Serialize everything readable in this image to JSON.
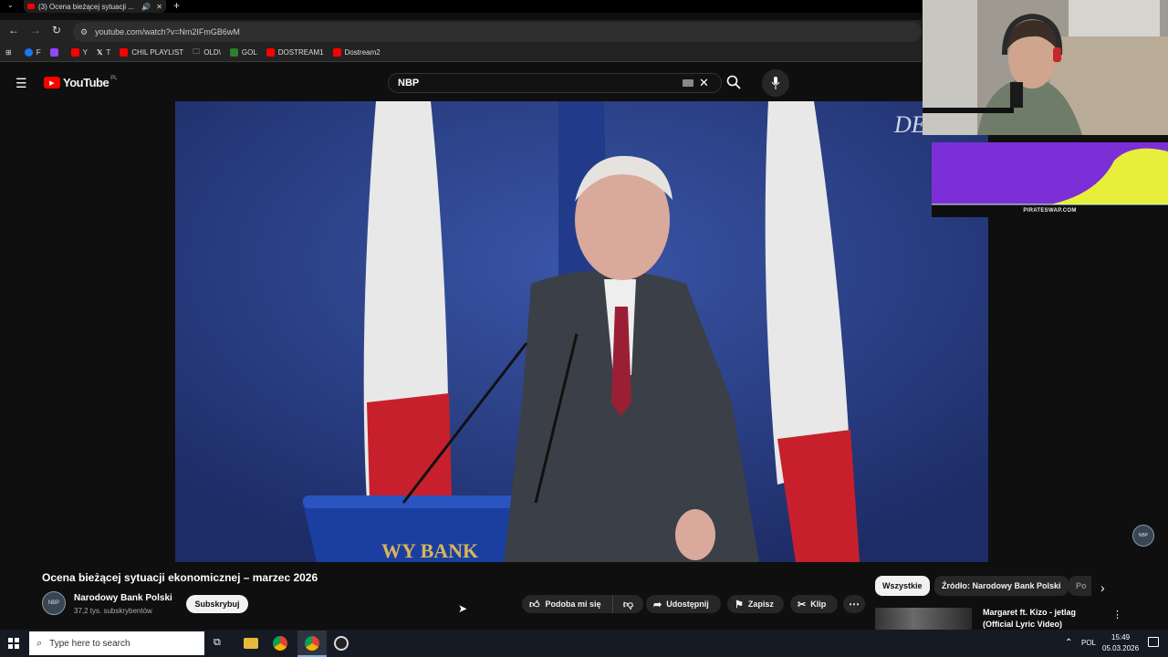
{
  "browser": {
    "tab_title": "(3) Ocena bieżącej sytuacji ...",
    "url": "youtube.com/watch?v=Nm2IFmGB6wM",
    "bookmarks": [
      {
        "label": "F",
        "color": "#1877f2"
      },
      {
        "label": "",
        "color": "#9146ff"
      },
      {
        "label": "Y",
        "color": "#ff0000"
      },
      {
        "label": "T",
        "color": "#ffffff"
      },
      {
        "label": "CHIL PLAYLIST",
        "color": "#ff0000"
      },
      {
        "label": "OLD\\",
        "color": "#dddddd"
      },
      {
        "label": "GOL",
        "color": "#2e7d32"
      },
      {
        "label": "DOSTREAM1",
        "color": "#ff0000"
      },
      {
        "label": "Dostream2",
        "color": "#ff0000"
      }
    ]
  },
  "youtube": {
    "logo_text": "YouTube",
    "region": "PL",
    "search_value": "NBP"
  },
  "overlay": {
    "ad_url": "PIRATESWAP.COM"
  },
  "video": {
    "title": "Ocena bieżącej sytuacji ekonomicznej – marzec 2026",
    "channel_name": "Narodowy Bank Polski",
    "subscribers": "37,2 tys. subskrybentów",
    "subscribe_label": "Subskrybuj",
    "avatar_text": "NBP",
    "watermark_text": "NBP",
    "podium_text": "WY BANK",
    "backdrop_text": "DE",
    "actions": {
      "like": "Podoba mi się",
      "share": "Udostępnij",
      "save": "Zapisz",
      "clip": "Klip"
    }
  },
  "chips": [
    "Wszystkie",
    "Źródło: Narodowy Bank Polski",
    "Po"
  ],
  "recommendation": {
    "title_line1": "Margaret ft. Kizo - jetlag",
    "title_line2": "(Official Lyric Video)"
  },
  "taskbar": {
    "search_placeholder": "Type here to search",
    "language": "POL",
    "time": "15:49",
    "date": "05.03.2026"
  }
}
